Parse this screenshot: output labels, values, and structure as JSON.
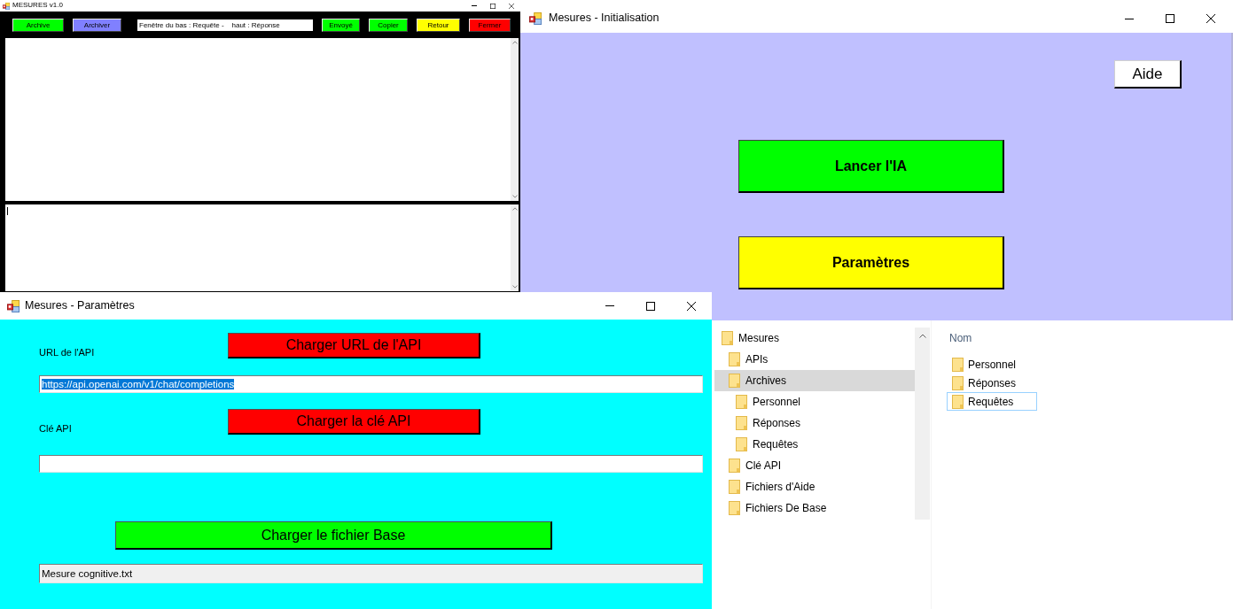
{
  "mesures_window": {
    "title": "MESURES v1.0",
    "toolbar": {
      "left_buttons": [
        {
          "label": "Archive",
          "color": "#00ff00"
        },
        {
          "label": "Archiver",
          "color": "#8080ff"
        }
      ],
      "info_field": {
        "value": "Fenêtre du bas : Requête -    haut : Réponse"
      },
      "right_buttons": [
        {
          "label": "Envoyé",
          "color": "#00ff00"
        },
        {
          "label": "Copier",
          "color": "#00ff00"
        },
        {
          "label": "Retour",
          "color": "#ffff00"
        },
        {
          "label": "Fermer",
          "color": "#ff0000"
        }
      ]
    },
    "upper_text_area": {
      "focused": false
    },
    "lower_text_area": {
      "focused": true
    }
  },
  "initialisation_window": {
    "title": "Mesures - Initialisation",
    "help_button": "Aide",
    "launch_button": "Lancer l'IA",
    "settings_button": "Paramètres"
  },
  "parametres_window": {
    "title": "Mesures - Paramètres",
    "api_url": {
      "label": "URL de l'API",
      "button": "Charger URL de l'API",
      "value": "https://api.openai.com/v1/chat/completions",
      "text_selected": true
    },
    "api_key": {
      "label": "Clé API",
      "button": "Charger la clé API"
    },
    "base_file": {
      "button": "Charger le fichier Base",
      "value": "Mesure cognitive.txt",
      "read_only": true
    }
  },
  "explorer": {
    "tree": [
      {
        "label": "Mesures",
        "selected": false,
        "children": [
          {
            "label": "APIs",
            "selected": false
          },
          {
            "label": "Archives",
            "selected": true,
            "children": [
              {
                "label": "Personnel",
                "selected": false
              },
              {
                "label": "Réponses",
                "selected": false
              },
              {
                "label": "Requêtes",
                "selected": false
              }
            ]
          },
          {
            "label": "Clé API",
            "selected": false
          },
          {
            "label": "Fichiers d'Aide",
            "selected": false
          },
          {
            "label": "Fichiers De Base",
            "selected": false
          }
        ]
      }
    ],
    "list": {
      "column": "Nom",
      "items": [
        {
          "label": "Personnel",
          "focused": false
        },
        {
          "label": "Réponses",
          "focused": false
        },
        {
          "label": "Requêtes",
          "focused": true
        }
      ]
    }
  }
}
